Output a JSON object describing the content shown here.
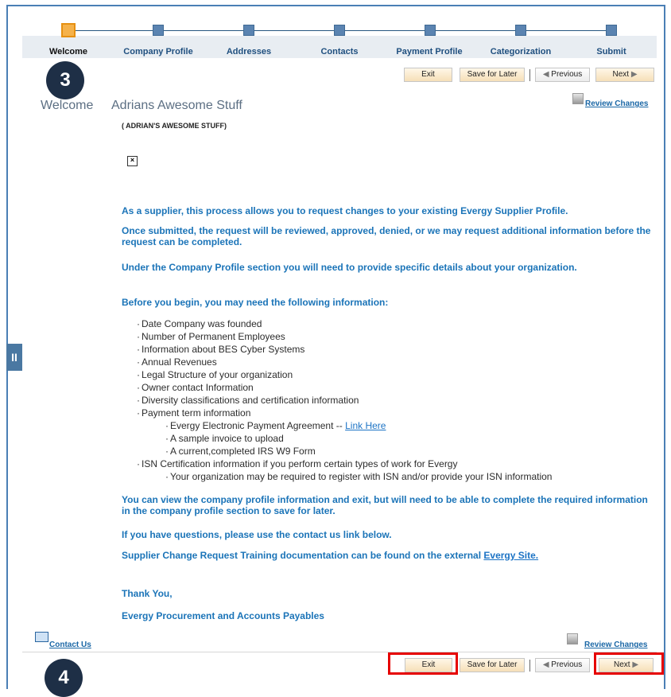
{
  "steps": [
    {
      "label": "Welcome",
      "active": true
    },
    {
      "label": "Company Profile",
      "active": false
    },
    {
      "label": "Addresses",
      "active": false
    },
    {
      "label": "Contacts",
      "active": false
    },
    {
      "label": "Payment Profile",
      "active": false
    },
    {
      "label": "Categorization",
      "active": false
    },
    {
      "label": "Submit",
      "active": false
    }
  ],
  "toolbar": {
    "exit": "Exit",
    "save_later": "Save for Later",
    "previous": "Previous",
    "next": "Next"
  },
  "badges": {
    "top": "3",
    "bottom": "4"
  },
  "header": {
    "welcome": "Welcome",
    "company": "Adrians Awesome Stuff",
    "subname": "( ADRIAN'S AWESOME STUFF)",
    "review_changes": "Review Changes"
  },
  "icons": {
    "review": "review-changes-icon",
    "broken": "broken-image-icon",
    "contact": "mail-icon",
    "collapse": "pause-icon"
  },
  "content": {
    "p1": "As a supplier, this process allows you to request changes to your existing Evergy Supplier Profile.",
    "p2": "Once submitted, the request will be reviewed, approved, denied, or we may request additional information before the request can be completed.",
    "p3": "Under the Company Profile section you will need to provide specific details about your organization.",
    "p4": "Before you begin, you may need the following information:",
    "list": [
      "Date Company was founded",
      "Number of Permanent Employees",
      "Information about BES Cyber Systems",
      "Annual Revenues",
      "Legal Structure of your organization",
      "Owner contact Information",
      "Diversity classifications and certification information",
      "Payment term information"
    ],
    "payment_sublist": {
      "agreement": "Evergy Electronic Payment Agreement --",
      "link": "Link Here",
      "invoice": "A sample invoice to upload",
      "irs": "A current,completed IRS W9 Form"
    },
    "isn": "ISN Certification information if you perform certain types of work for Evergy",
    "isn_sub": "Your organization may be required to register with ISN and/or provide your ISN information",
    "p5": "You can view the company profile information and exit, but will need to be able to complete the required information in the company profile section to save for later.",
    "p6": "If you have questions, please use the contact us link below.",
    "p7": "Supplier Change Request Training documentation can be found on the external",
    "evergy_site": "Evergy Site.",
    "thanks": "Thank You,",
    "team": "Evergy Procurement and Accounts Payables"
  },
  "footer": {
    "contact_us": "Contact Us",
    "review_changes": "Review Changes"
  },
  "colors": {
    "accent": "#1b74b8",
    "highlight": "#e60000",
    "active_step": "#f5b24b"
  }
}
